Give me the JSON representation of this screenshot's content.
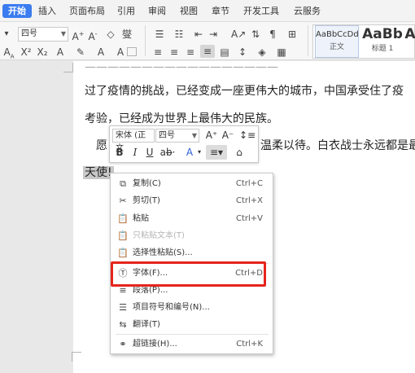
{
  "menu": {
    "tabs": [
      "开始",
      "插入",
      "页面布局",
      "引用",
      "审阅",
      "视图",
      "章节",
      "开发工具",
      "云服务"
    ],
    "active_index": 0,
    "accent": "#3b7cf0"
  },
  "ribbon": {
    "font_size": "四号",
    "style_gallery": [
      {
        "sample": "AaBbCcDd",
        "label": "正文"
      },
      {
        "sample": "AaBb",
        "label": "标题 1"
      },
      {
        "sample": "A",
        "label": ""
      }
    ]
  },
  "document": {
    "lines": [
      "过了疫情的挑战，已经变成一座更伟大的城市，中国承受住了疫",
      "考验，已经成为世界上最伟大的民族。",
      "愿",
      "温柔以待。白衣战士永远都是最"
    ],
    "selected_text": "天使!"
  },
  "mini_toolbar": {
    "font_name": "宋体 (正文",
    "font_size": "四号",
    "grow_icon": "A⁺",
    "shrink_icon": "A⁻",
    "bold": "B",
    "italic": "I",
    "underline": "U"
  },
  "context_menu": {
    "items": [
      {
        "icon": "copy-icon",
        "glyph": "⧉",
        "label": "复制(C)",
        "shortcut": "Ctrl+C",
        "enabled": true
      },
      {
        "icon": "cut-icon",
        "glyph": "✂",
        "label": "剪切(T)",
        "shortcut": "Ctrl+X",
        "enabled": true
      },
      {
        "icon": "paste-icon",
        "glyph": "📋",
        "label": "粘贴",
        "shortcut": "Ctrl+V",
        "enabled": true
      },
      {
        "icon": "paste-text-icon",
        "glyph": "📋",
        "label": "只粘贴文本(T)",
        "shortcut": "",
        "enabled": false
      },
      {
        "icon": "paste-special-icon",
        "glyph": "📋",
        "label": "选择性粘贴(S)...",
        "shortcut": "",
        "enabled": true
      },
      {
        "icon": "font-icon",
        "glyph": "Ⓣ",
        "label": "字体(F)...",
        "shortcut": "Ctrl+D",
        "enabled": true
      },
      {
        "icon": "paragraph-icon",
        "glyph": "≡",
        "label": "段落(P)...",
        "shortcut": "",
        "enabled": true
      },
      {
        "icon": "bullets-numbering-icon",
        "glyph": "☰",
        "label": "项目符号和编号(N)...",
        "shortcut": "",
        "enabled": true
      },
      {
        "icon": "translate-icon",
        "glyph": "⇆",
        "label": "翻译(T)",
        "shortcut": "",
        "enabled": true
      },
      {
        "icon": "hyperlink-icon",
        "glyph": "⚭",
        "label": "超链接(H)...",
        "shortcut": "Ctrl+K",
        "enabled": true
      }
    ],
    "highlight_color": "#e5251d"
  }
}
